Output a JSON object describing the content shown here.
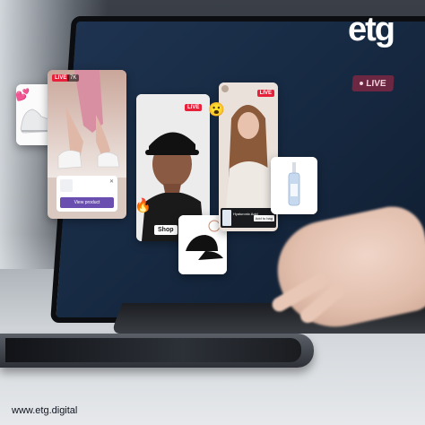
{
  "brand": {
    "logo_text": "etg",
    "website": "www.etg.digital",
    "accent": "#8b3cf6"
  },
  "screen_badge": {
    "label": "LIVE"
  },
  "cards": {
    "sneaker_stream": {
      "live_label": "LIVE",
      "viewer_count": "7K",
      "button_label": "View product"
    },
    "cap_stream": {
      "live_label": "LIVE",
      "button_label": "Shop"
    },
    "beauty_stream": {
      "live_label": "LIVE",
      "product_name": "Hyaluronic Acid",
      "button_label": "Add to bag"
    }
  },
  "reactions": {
    "hearts": "💕",
    "fire": "🔥",
    "wow": "😮"
  },
  "colors": {
    "live_red": "#e8213b",
    "product_purple": "#6a4fb0"
  }
}
